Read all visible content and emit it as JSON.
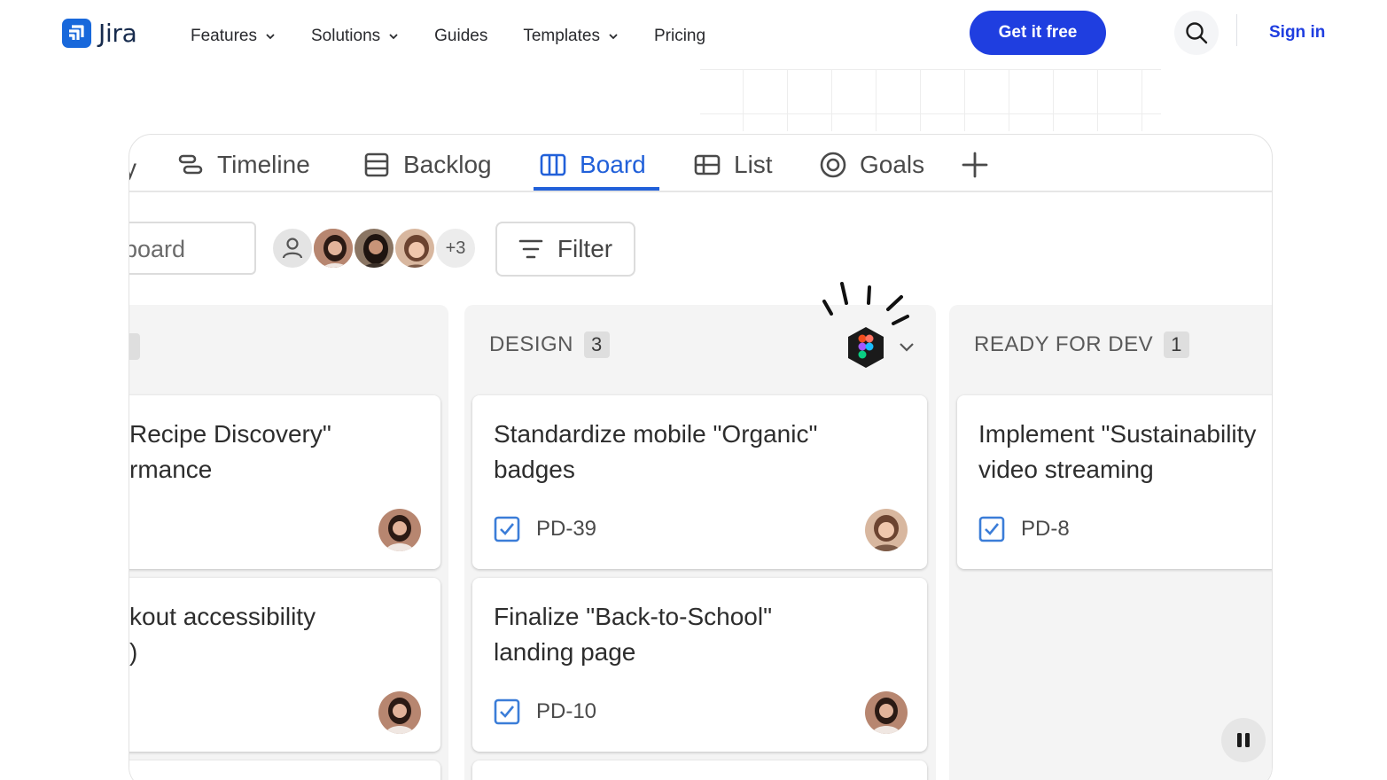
{
  "brand": {
    "name": "Jira",
    "accent": "#1f3ee0"
  },
  "nav": {
    "items": [
      {
        "label": "Features",
        "has_dropdown": true
      },
      {
        "label": "Solutions",
        "has_dropdown": true
      },
      {
        "label": "Guides",
        "has_dropdown": false
      },
      {
        "label": "Templates",
        "has_dropdown": true
      },
      {
        "label": "Pricing",
        "has_dropdown": false
      }
    ],
    "cta_label": "Get it free",
    "search_icon": "search-icon",
    "signin_label": "Sign in"
  },
  "product": {
    "tabs": [
      {
        "label": "Timeline",
        "icon": "timeline-icon",
        "active": false
      },
      {
        "label": "Backlog",
        "icon": "backlog-icon",
        "active": false
      },
      {
        "label": "Board",
        "icon": "board-icon",
        "active": true
      },
      {
        "label": "List",
        "icon": "list-icon",
        "active": false
      },
      {
        "label": "Goals",
        "icon": "goals-icon",
        "active": false
      }
    ],
    "partial_tab_text": "y",
    "add_tab_icon": "plus-icon",
    "search_value": "board",
    "avatars_more": "+3",
    "filter_label": "Filter",
    "columns": [
      {
        "title": "",
        "count": "",
        "cards": [
          {
            "title_line1": "Recipe Discovery\"",
            "title_line2": "rmance",
            "key": ""
          },
          {
            "title_line1": "kout accessibility",
            "title_line2": ")",
            "key": ""
          }
        ]
      },
      {
        "title": "DESIGN",
        "count": "3",
        "cards": [
          {
            "title_line1": "Standardize mobile \"Organic\"",
            "title_line2": "badges",
            "key": "PD-39"
          },
          {
            "title_line1": "Finalize \"Back-to-School\"",
            "title_line2": "landing page",
            "key": "PD-10"
          }
        ]
      },
      {
        "title": "READY FOR DEV",
        "count": "1",
        "cards": [
          {
            "title_line1": "Implement \"Sustainability",
            "title_line2": "video streaming",
            "key": "PD-8"
          }
        ]
      }
    ],
    "pause_icon": "pause-icon"
  }
}
